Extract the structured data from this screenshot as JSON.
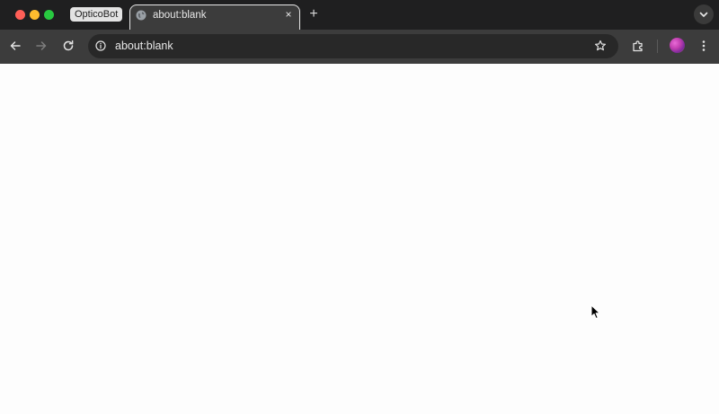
{
  "window": {
    "tab_group_label": "OpticoBot",
    "tab": {
      "title": "about:blank",
      "close_glyph": "×"
    },
    "new_tab_glyph": "+"
  },
  "toolbar": {
    "address": "about:blank"
  },
  "icons": {
    "back": "arrow-left-icon",
    "forward": "arrow-right-icon",
    "reload": "reload-icon",
    "site_info": "info-icon",
    "bookmark": "star-icon",
    "extensions": "puzzle-icon",
    "menu": "kebab-menu-icon",
    "tab_search": "chevron-down-icon"
  },
  "colors": {
    "titlebar": "#1f1f20",
    "toolbar": "#3c3c3c",
    "omnibox": "#282828",
    "page_background": "#fdfdfd"
  }
}
